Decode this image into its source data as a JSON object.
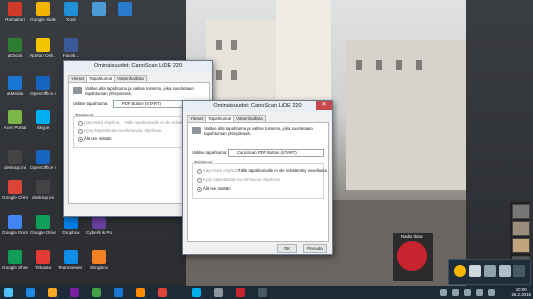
{
  "desktop_icons": [
    {
      "label": "Romakori",
      "color": "#d23b2a"
    },
    {
      "label": "Google Sides",
      "color": "#f4b400"
    },
    {
      "label": "Kodi",
      "color": "#1f8fd6"
    },
    {
      "label": "",
      "color": "#4c9bd6"
    },
    {
      "label": "",
      "color": "#2a7ad0"
    },
    {
      "label": "atOcos",
      "color": "#2e7d32"
    },
    {
      "label": "Norton Onli...",
      "color": "#f5c400"
    },
    {
      "label": "Faceb...",
      "color": "#3b5998"
    },
    {
      "label": "atMedia",
      "color": "#1976d2"
    },
    {
      "label": "OpenOffice 4.1.1",
      "color": "#1565c0"
    },
    {
      "label": "Acer Portal",
      "color": "#7ab648"
    },
    {
      "label": "Skype",
      "color": "#00aff0"
    },
    {
      "label": "desktop.ini",
      "color": "#444"
    },
    {
      "label": "OpenOffice 4.1.1 (2)",
      "color": "#1565c0"
    },
    {
      "label": "Google Chrome",
      "color": "#db4437"
    },
    {
      "label": "desktop.ini",
      "color": "#444"
    },
    {
      "label": "Google Docs",
      "color": "#4285f4"
    },
    {
      "label": "Google Drive",
      "color": "#0f9d58"
    },
    {
      "label": "Dropbox",
      "color": "#007ee5"
    },
    {
      "label": "Cyberlink PowerEditor",
      "color": "#6b3fa0"
    },
    {
      "label": "Google Sheets",
      "color": "#0f9d58"
    },
    {
      "label": "Tirkasta",
      "color": "#e53935"
    },
    {
      "label": "Teamviewer 10",
      "color": "#0e8ee9"
    },
    {
      "label": "Stingbox",
      "color": "#f48024"
    }
  ],
  "dialog_back": {
    "title": "Ominaisuudet: CanoScan LiDE 220",
    "tabs": [
      "Yleiset",
      "Tapahtumat",
      "Värienhallinta"
    ],
    "instruction": "Valitse alla tapahtuma ja valitse toiminto, joka suoritetaan tapahtuman yhteydessä.",
    "event_label": "Valitse tapahtuma:",
    "event_value": "PDF Button (START)",
    "group_label": "Toiminnot",
    "opt1": "Käynnistä ohjelma:",
    "opt1_value": "Tälle tapahtumalle ei ole rekisteröity",
    "opt2": "Kysy käytettävää suoritettavaa ohjelmaa",
    "opt3": "Älä tee mitään",
    "ok": "OK"
  },
  "dialog_front": {
    "title": "Ominaisuudet: CanoScan LiDE 220",
    "tabs": [
      "Yleiset",
      "Tapahtumat",
      "Värienhallinta"
    ],
    "instruction": "Valitse alla tapahtuma ja valitse toiminto, joka suoritetaan tapahtuman yhteydessä.",
    "event_label": "Valitse tapahtuma:",
    "event_value": "CanoScan PDF Button (START)",
    "group_label": "Toiminnot",
    "opt1": "Käynnistä ohjelma:",
    "opt1_value": "Tälle tapahtumalle ei ole rekisteröity sovellusta",
    "opt2": "Kysy käytettävää suoritettavaa ohjelmaa",
    "opt3": "Älä tee mitään",
    "ok": "OK",
    "cancel": "Peruuta"
  },
  "disc_widget": {
    "label": "Radio Ibiza"
  },
  "clock": {
    "time": "10:00",
    "date": "26.2.2015"
  }
}
